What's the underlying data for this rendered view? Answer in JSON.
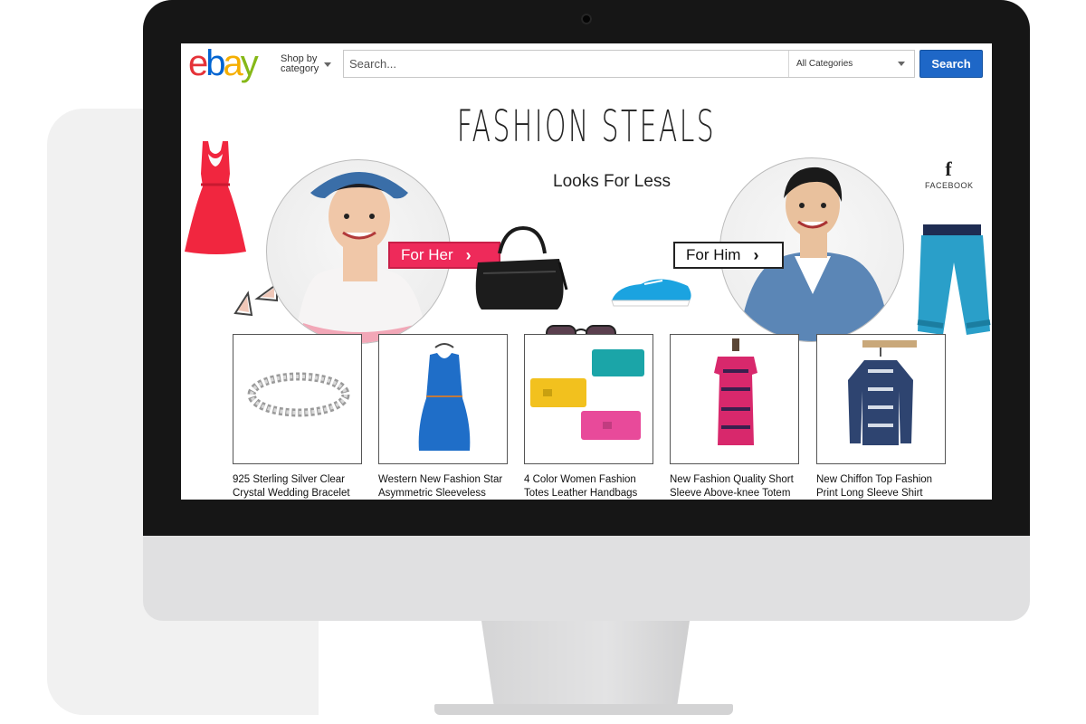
{
  "header": {
    "logo_letters": [
      {
        "char": "e",
        "color": "#e53238"
      },
      {
        "char": "b",
        "color": "#0064d2"
      },
      {
        "char": "a",
        "color": "#f5af02"
      },
      {
        "char": "y",
        "color": "#86b817"
      }
    ],
    "shop_by_line1": "Shop by",
    "shop_by_line2": "category",
    "search_placeholder": "Search...",
    "category_selected": "All Categories",
    "search_button": "Search"
  },
  "hero": {
    "title": "FASHION STEALS",
    "subtitle": "Looks For Less",
    "for_her": "For Her",
    "for_him": "For Him",
    "social_label": "FACEBOOK",
    "social_icon": "f"
  },
  "products": [
    {
      "title": "925 Sterling Silver Clear Crystal Wedding Bracelet",
      "icon": "bracelet"
    },
    {
      "title": "Western New Fashion Star Asymmetric Sleeveless",
      "icon": "blue-dress"
    },
    {
      "title": "4 Color Women Fashion Totes Leather Handbags",
      "icon": "wallets"
    },
    {
      "title": "New Fashion Quality Short Sleeve Above-knee Totem",
      "icon": "print-dress"
    },
    {
      "title": "New Chiffon Top Fashion Print Long Sleeve Shirt",
      "icon": "shirt"
    }
  ],
  "colors": {
    "accent_pink": "#ee2a5a",
    "search_blue": "#1e67c7",
    "bezel": "#161616"
  }
}
